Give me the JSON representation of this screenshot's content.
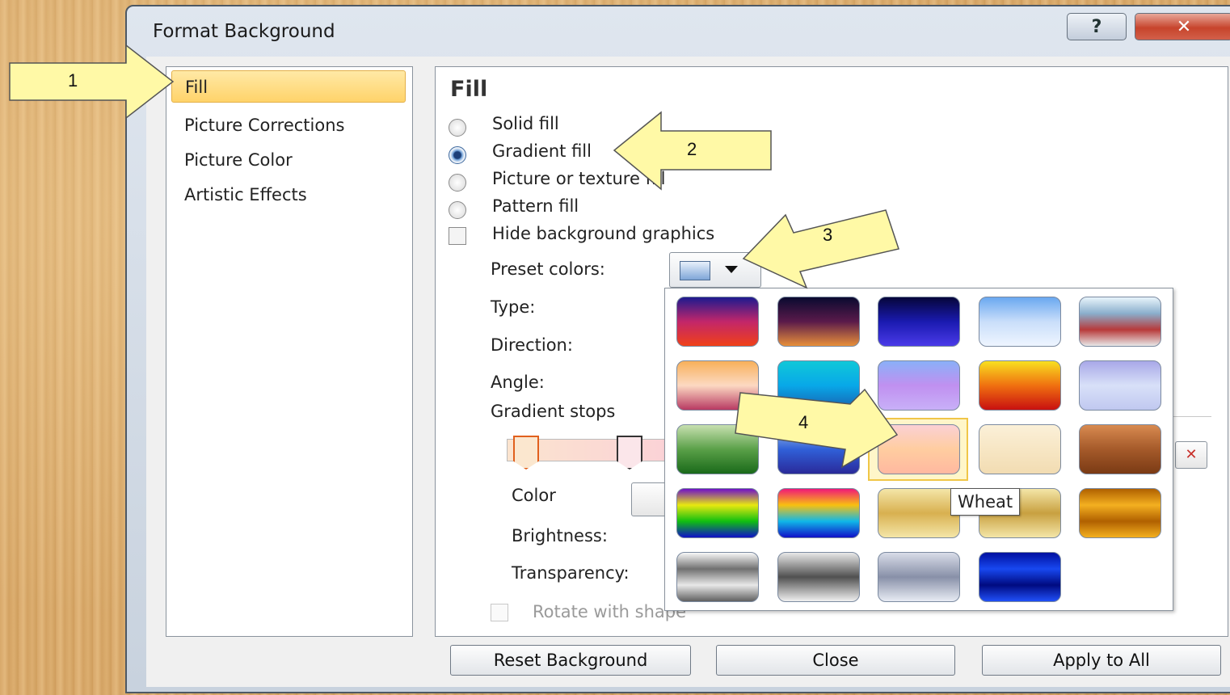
{
  "dialog": {
    "title": "Format Background",
    "help_glyph": "?",
    "close_glyph": "✕"
  },
  "nav": {
    "items": [
      {
        "label": "Fill",
        "selected": true
      },
      {
        "label": "Picture Corrections",
        "selected": false
      },
      {
        "label": "Picture Color",
        "selected": false
      },
      {
        "label": "Artistic Effects",
        "selected": false
      }
    ]
  },
  "fill": {
    "heading": "Fill",
    "options": [
      {
        "label": "Solid fill",
        "selected": false
      },
      {
        "label": "Gradient fill",
        "selected": true
      },
      {
        "label": "Picture or texture fill",
        "selected": false
      },
      {
        "label": "Pattern fill",
        "selected": false
      }
    ],
    "hide_graphics_label": "Hide background graphics",
    "preset_label": "Preset colors:",
    "type_label": "Type:",
    "direction_label": "Direction:",
    "angle_label": "Angle:",
    "gradient_stops_label": "Gradient stops",
    "color_label": "Color",
    "brightness_label": "Brightness:",
    "transparency_label": "Transparency:",
    "rotate_label": "Rotate with shape"
  },
  "gallery": {
    "hovered_name": "Wheat",
    "swatches": [
      [
        "#1d1a8f,#c2266a,#f04018",
        "#0a0a30,#5a1a4a,#e8903a",
        "#06063a,#1a1ab0,#4a3ae8",
        "#6aa8f0,#c9defa,#eef5ff",
        "#e8f4fb,#8aaecc,#b83a3a,#e8e8e8"
      ],
      [
        "#f8b05a,#fcd9c2,#b83a62",
        "#10c8d8,#08a8e8,#1860b0",
        "#8ab0f8,#c090f0,#c8b0f8",
        "#f8e020,#f07010,#c81010",
        "#a8a8e8,#d8e0f8,#c0c8f0"
      ],
      [
        "#c8e0b0,#5aa048,#1a6a1a",
        "#a8c8e8,#3060d8,#2a2a9a",
        "#fbd0d4,#ffcda0,#ffb8a0",
        "#fbf0d8,#f7e6c4,#f2dcb2",
        "#d88a50,#a55a2a,#7a3a14"
      ],
      [
        "#7010c8,#e8e810,#10c010,#1010c8",
        "#f01878,#f8c010,#10b8e8,#1010c8",
        "#f4e6a8,#d8b050,#f4e6a8",
        "#f4e6a8,#c8a040,#f4e6a8",
        "#b06000,#f4b020,#b06000,#f4b020"
      ],
      [
        "#f8f8f8,#707070,#e8e8e8,#606060",
        "#e8e8e8,#505050,#f0f0f0",
        "#d8dce8,#8890a8,#e8ecf4",
        "#0010a0,#1848f0,#000a80,#2050f8",
        ""
      ]
    ]
  },
  "buttons": {
    "reset": "Reset Background",
    "close": "Close",
    "apply_all": "Apply to All"
  },
  "callouts": [
    "1",
    "2",
    "3",
    "4"
  ]
}
